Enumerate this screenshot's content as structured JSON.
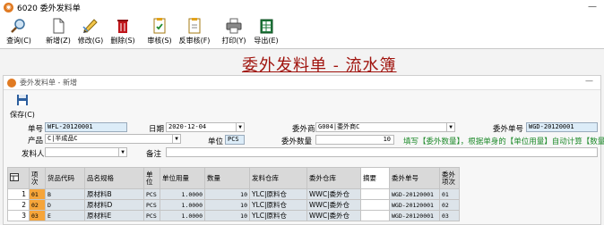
{
  "window": {
    "title": "6020 委外发料单",
    "min": "—"
  },
  "toolbar": {
    "buttons": [
      {
        "label": "查询(C)"
      },
      {
        "label": "新增(Z)"
      },
      {
        "label": "修改(G)"
      },
      {
        "label": "删除(S)"
      },
      {
        "label": "审核(S)"
      },
      {
        "label": "反审核(F)"
      },
      {
        "label": "打印(Y)"
      },
      {
        "label": "导出(E)"
      }
    ]
  },
  "page_title": "委外发料单 - 流水簿",
  "inner": {
    "title": "委外发料单 - 新增",
    "min": "—",
    "save_label": "保存(C)"
  },
  "form": {
    "order_no_label": "单号",
    "order_no": "WFL-20120001",
    "date_label": "日期",
    "date": "2020-12-04",
    "vendor_label": "委外商",
    "vendor": "G004|委外商C",
    "out_order_label": "委外单号",
    "out_order": "WGD-20120001",
    "product_label": "产品",
    "product": "C|半成品C",
    "unit_label": "单位",
    "unit": "PCS",
    "qty_label": "委外数量",
    "qty": "10",
    "hint": "填写【委外数量】，根据单身的【单位用量】自动计算【数量】",
    "issuer_label": "发料人",
    "issuer": "",
    "remark_label": "备注",
    "remark": ""
  },
  "grid": {
    "columns": [
      "项次",
      "货品代码",
      "品名规格",
      "单位",
      "单位用量",
      "数量",
      "发料仓库",
      "委外仓库",
      "摘要",
      "委外单号",
      "委外项次"
    ],
    "rows": [
      {
        "no": "1",
        "seq": "01",
        "code": "B",
        "name": "原材料B",
        "unit": "PCS",
        "usage": "1.0000",
        "qty": "10",
        "wh_out": "YLC|原料仓",
        "wh_in": "WWC|委外仓",
        "memo": "",
        "order": "WGD-20120001",
        "item": "01"
      },
      {
        "no": "2",
        "seq": "02",
        "code": "D",
        "name": "原材料D",
        "unit": "PCS",
        "usage": "1.0000",
        "qty": "10",
        "wh_out": "YLC|原料仓",
        "wh_in": "WWC|委外仓",
        "memo": "",
        "order": "WGD-20120001",
        "item": "02"
      },
      {
        "no": "3",
        "seq": "03",
        "code": "E",
        "name": "原材料E",
        "unit": "PCS",
        "usage": "1.0000",
        "qty": "10",
        "wh_out": "YLC|原料仓",
        "wh_in": "WWC|委外仓",
        "memo": "",
        "order": "WGD-20120001",
        "item": "03"
      }
    ]
  }
}
